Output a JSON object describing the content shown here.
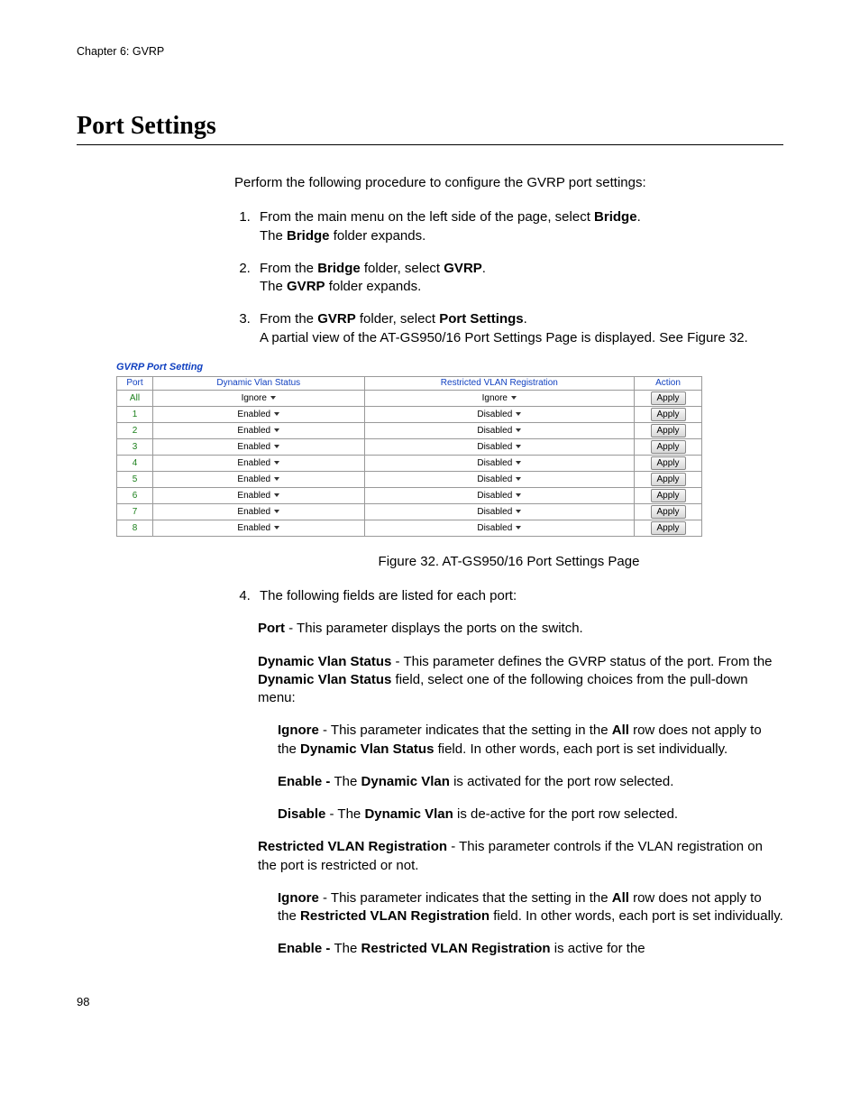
{
  "header": {
    "running": "Chapter 6: GVRP"
  },
  "title": "Port Settings",
  "intro": "Perform the following procedure to configure the GVRP port settings:",
  "steps": {
    "s1a": "From the main menu on the left side of the page, select ",
    "s1b": "Bridge",
    "s1c": ".",
    "s1d": "The ",
    "s1e": "Bridge",
    "s1f": " folder expands.",
    "s2a": "From the ",
    "s2b": "Bridge",
    "s2c": " folder, select ",
    "s2d": "GVRP",
    "s2e": ".",
    "s2f": "The ",
    "s2g": "GVRP",
    "s2h": " folder expands.",
    "s3a": "From the ",
    "s3b": "GVRP",
    "s3c": " folder, select ",
    "s3d": "Port Settings",
    "s3e": ".",
    "s3f": "A partial view of the AT-GS950/16 Port Settings Page is displayed. See Figure 32.",
    "s4": "The following fields are listed for each port:"
  },
  "figure": {
    "panel_title": "GVRP Port Setting",
    "headers": {
      "port": "Port",
      "dvs": "Dynamic Vlan Status",
      "rvr": "Restricted VLAN Registration",
      "action": "Action"
    },
    "rows": [
      {
        "port": "All",
        "dvs": "Ignore",
        "rvr": "Ignore",
        "action": "Apply"
      },
      {
        "port": "1",
        "dvs": "Enabled",
        "rvr": "Disabled",
        "action": "Apply"
      },
      {
        "port": "2",
        "dvs": "Enabled",
        "rvr": "Disabled",
        "action": "Apply"
      },
      {
        "port": "3",
        "dvs": "Enabled",
        "rvr": "Disabled",
        "action": "Apply"
      },
      {
        "port": "4",
        "dvs": "Enabled",
        "rvr": "Disabled",
        "action": "Apply"
      },
      {
        "port": "5",
        "dvs": "Enabled",
        "rvr": "Disabled",
        "action": "Apply"
      },
      {
        "port": "6",
        "dvs": "Enabled",
        "rvr": "Disabled",
        "action": "Apply"
      },
      {
        "port": "7",
        "dvs": "Enabled",
        "rvr": "Disabled",
        "action": "Apply"
      },
      {
        "port": "8",
        "dvs": "Enabled",
        "rvr": "Disabled",
        "action": "Apply"
      }
    ],
    "caption": "Figure 32. AT-GS950/16 Port Settings Page"
  },
  "defs": {
    "port_l": "Port",
    "port_t": " - This parameter displays the ports on the switch.",
    "dvs_l": "Dynamic Vlan Status",
    "dvs_t1": " - This parameter defines the GVRP status of the port. From the ",
    "dvs_b": "Dynamic Vlan Status",
    "dvs_t2": " field, select one of the following choices from the pull-down menu:",
    "ig_l": "Ignore",
    "ig_t1": " - This parameter indicates that the setting in the ",
    "ig_b": "All",
    "ig_t2": " row does not apply to the ",
    "ig_b2": "Dynamic Vlan Status",
    "ig_t3": " field. In other words, each port is set individually.",
    "en_l": "Enable - ",
    "en_t1": "The ",
    "en_b": "Dynamic Vlan",
    "en_t2": " is activated for the port row selected.",
    "dis_l": "Disable",
    "dis_t1": " - The ",
    "dis_b": "Dynamic Vlan",
    "dis_t2": " is de-active for the port row selected.",
    "rvr_l": "Restricted VLAN Registration",
    "rvr_t": " - This parameter controls if the VLAN registration on the port is restricted or not.",
    "rig_l": "Ignore",
    "rig_t1": " - This parameter indicates that the setting in the ",
    "rig_b": "All",
    "rig_t2": " row does not apply to the ",
    "rig_b2": "Restricted VLAN Registration",
    "rig_t3": " field. In other words, each port is set individually.",
    "ren_l": "Enable - ",
    "ren_t1": "The ",
    "ren_b": "Restricted VLAN Registration",
    "ren_t2": " is active for the"
  },
  "page_number": "98"
}
